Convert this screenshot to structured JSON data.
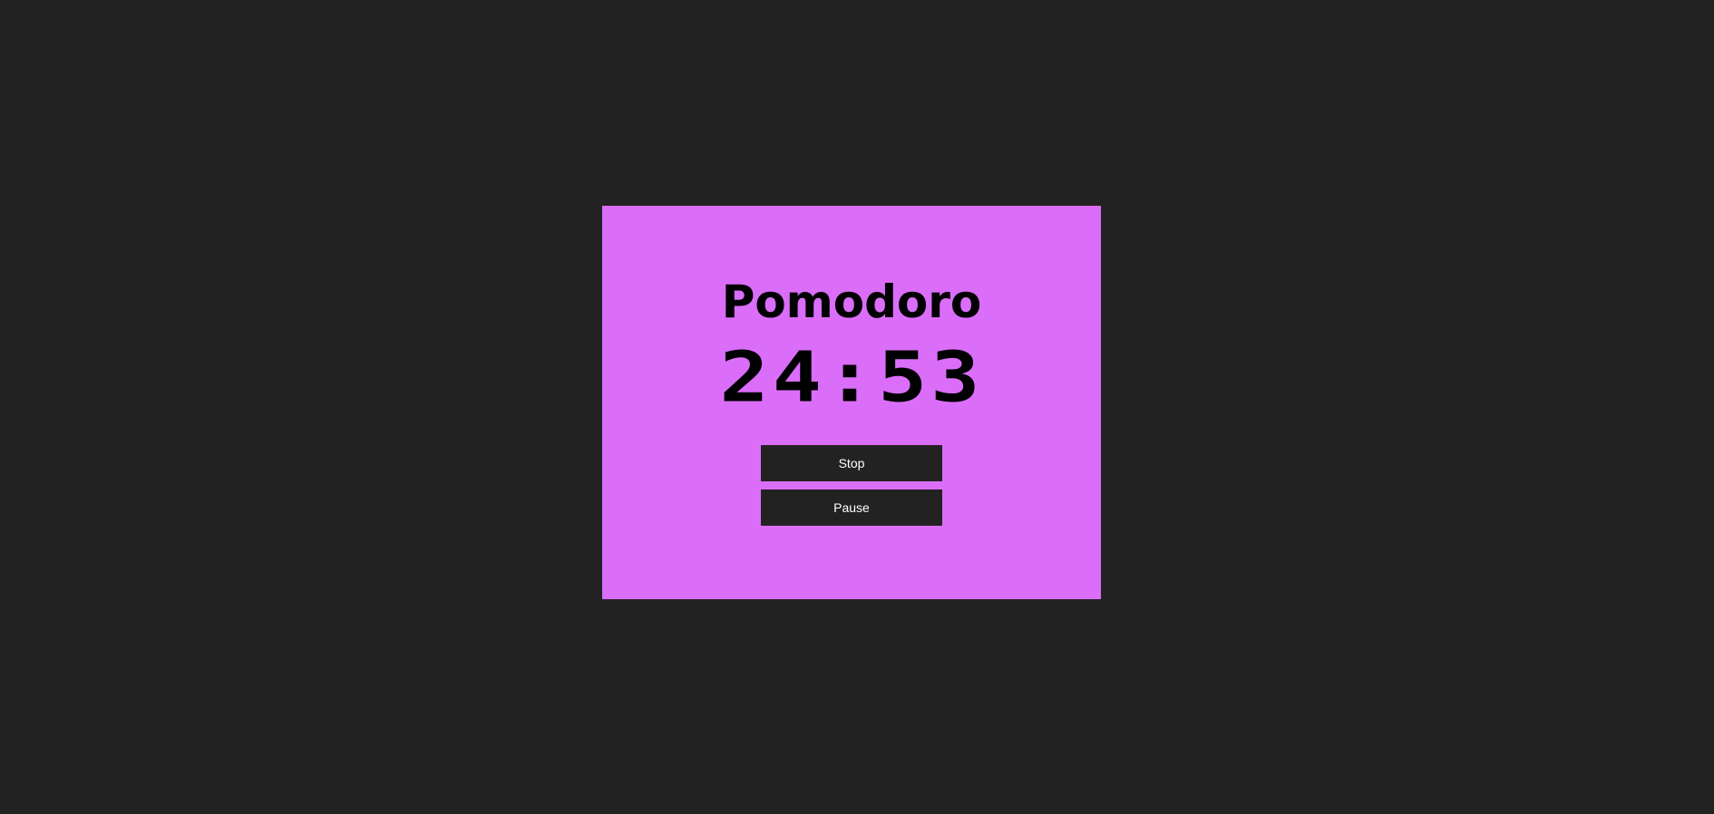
{
  "app": {
    "title": "Pomodoro"
  },
  "timer": {
    "display": "24:53",
    "minutes": 24,
    "seconds": 53
  },
  "controls": {
    "stop_label": "Stop",
    "pause_label": "Pause"
  },
  "colors": {
    "page_background": "#222222",
    "card_background": "#da6ef9",
    "button_background": "#222222",
    "button_text": "#ffffff",
    "text": "#000000"
  }
}
